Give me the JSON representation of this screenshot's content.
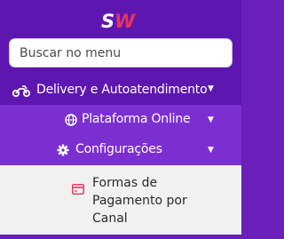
{
  "brand": {
    "logo_text": "SW",
    "logo_color": "#e8345a"
  },
  "search": {
    "placeholder": "Buscar no menu",
    "value": ""
  },
  "menu": {
    "level1": {
      "label": "Delivery e Autoatendimento",
      "icon": "motorcycle-icon",
      "expanded": true
    },
    "level2": [
      {
        "label": "Plataforma Online",
        "icon": "globe-icon",
        "expanded": false
      },
      {
        "label": "Configurações",
        "icon": "gear-icon",
        "expanded": true
      }
    ],
    "level3": [
      {
        "label": "Formas de Pagamento por Canal",
        "icon": "credit-card-icon"
      }
    ]
  },
  "colors": {
    "header_bg": "#5d17b0",
    "submenu_bg": "#7b2fd0",
    "panel_bg": "#f1f1f1",
    "accent_red": "#e8345a"
  }
}
